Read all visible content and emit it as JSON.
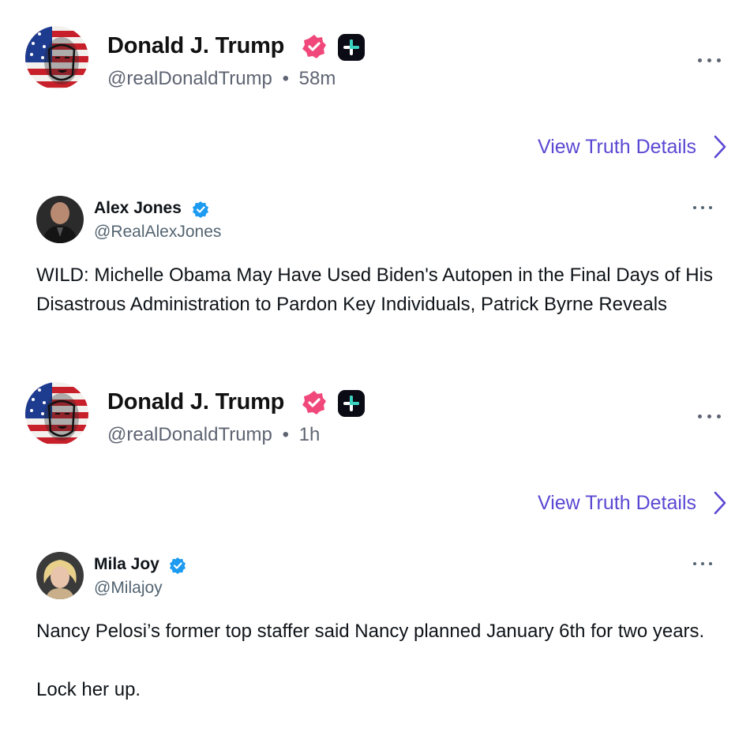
{
  "posts": [
    {
      "author": {
        "name": "Donald J. Trump",
        "handle": "@realDonaldTrump",
        "separator": "•",
        "time": "58m"
      },
      "view_details_label": "View Truth Details",
      "quoted": {
        "name": "Alex Jones",
        "handle": "@RealAlexJones",
        "text": "WILD: Michelle Obama May Have Used Biden's Autopen in the Final Days of His Disastrous Administration to Pardon Key Individuals, Patrick Byrne Reveals"
      }
    },
    {
      "author": {
        "name": "Donald J. Trump",
        "handle": "@realDonaldTrump",
        "separator": "•",
        "time": "1h"
      },
      "view_details_label": "View Truth Details",
      "quoted": {
        "name": "Mila Joy",
        "handle": "@Milajoy",
        "text": "Nancy Pelosi’s former top staffer said Nancy planned January 6th for two years.\n\nLock her up."
      }
    }
  ],
  "colors": {
    "accent": "#5a48d3",
    "truth_verified": "#f0487a",
    "x_verified": "#1d9bf0",
    "muted": "#5e6472"
  },
  "icons": {
    "truth_verified": "verified-badge-icon",
    "truth_plus": "plus-badge-icon",
    "more": "more-options-icon",
    "chevron": "chevron-right-icon"
  }
}
